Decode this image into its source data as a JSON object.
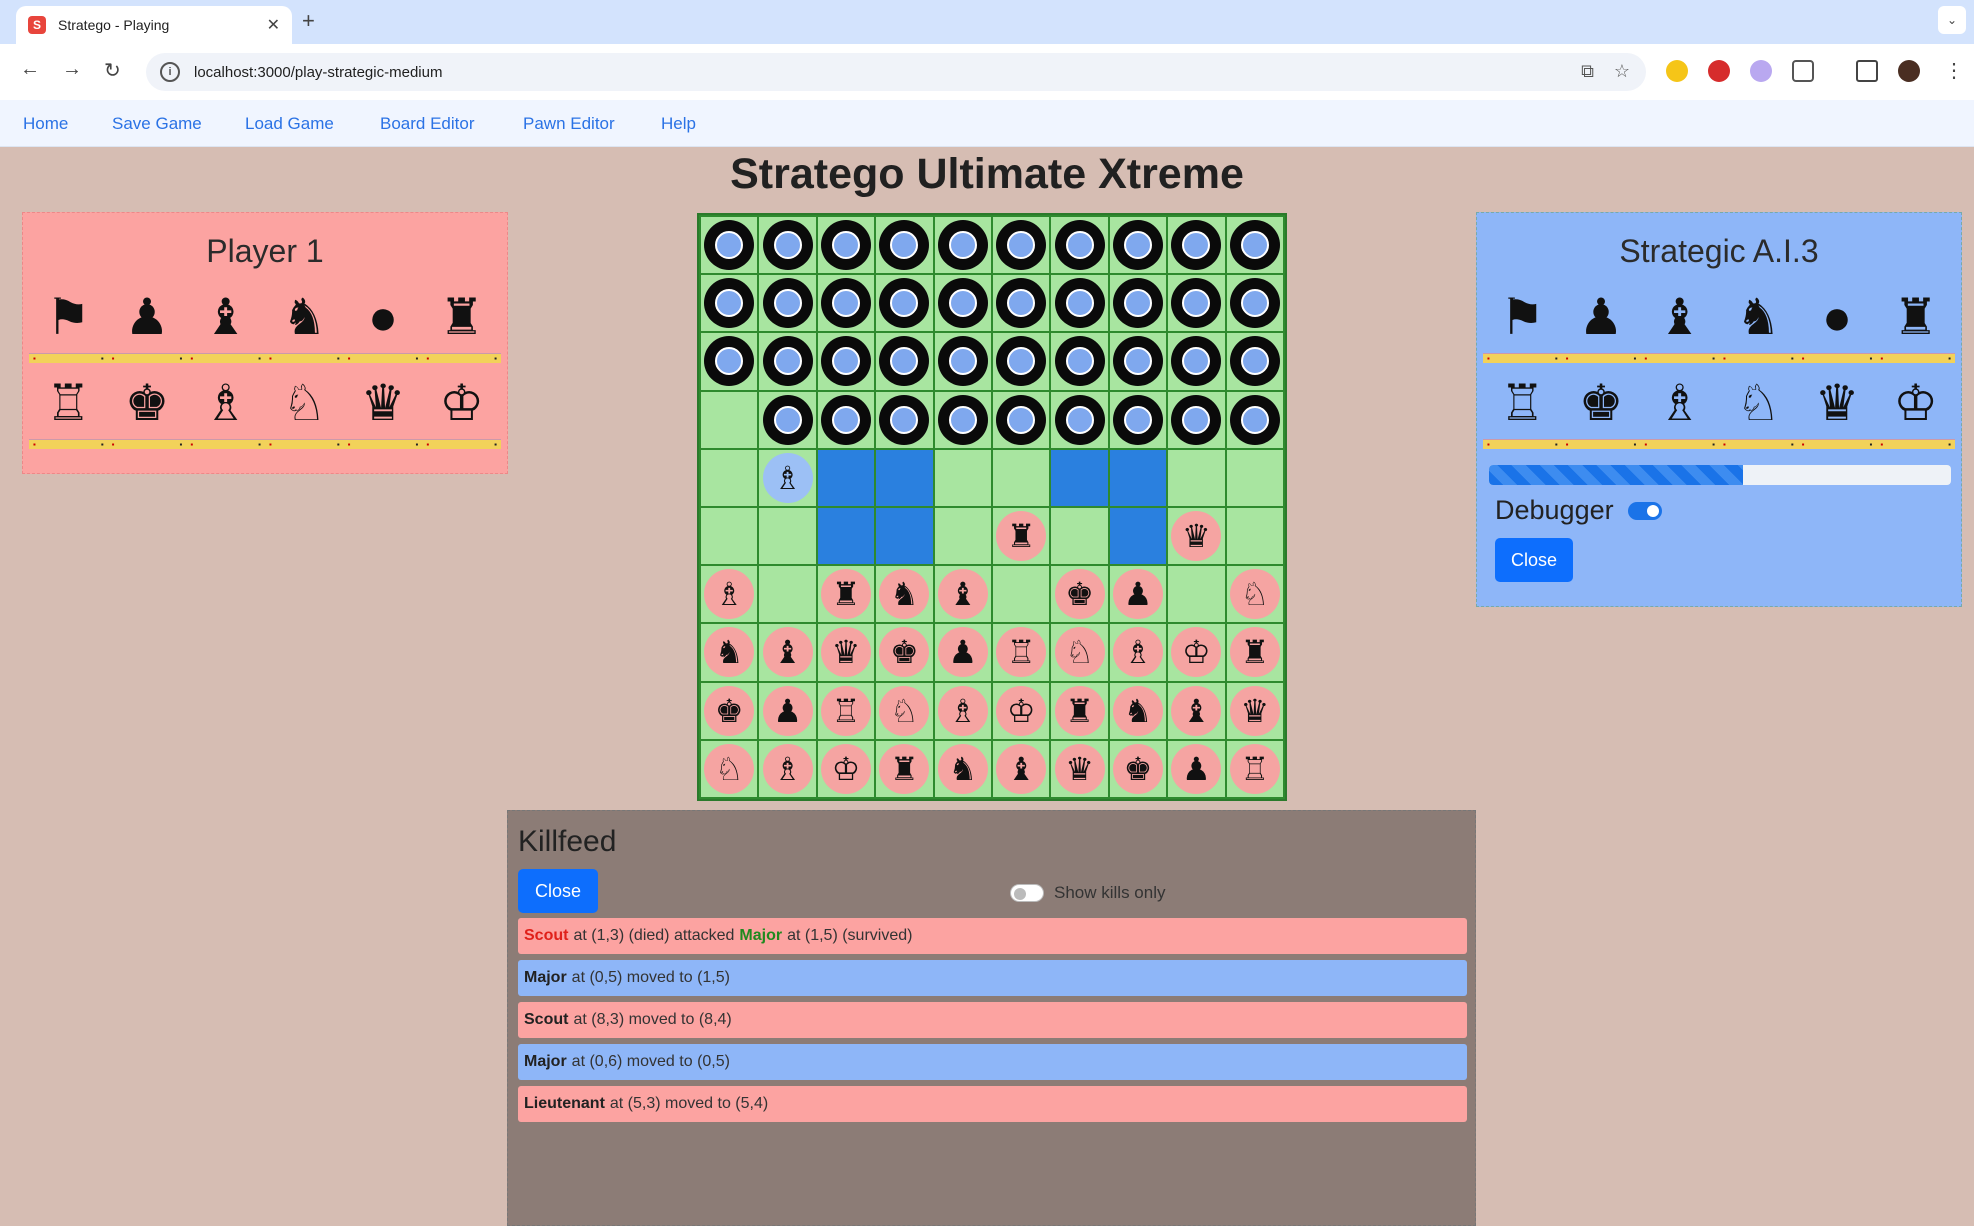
{
  "browser": {
    "tab_title": "Stratego - Playing",
    "tab_favicon": "S",
    "url": "localhost:3000/play-strategic-medium"
  },
  "appnav": {
    "links": [
      "Home",
      "Save Game",
      "Load Game",
      "Board Editor",
      "Pawn Editor",
      "Help"
    ]
  },
  "page_title": "Stratego Ultimate Xtreme",
  "player_panel": {
    "title": "Player 1"
  },
  "ai_panel": {
    "title": "Strategic A.I.3",
    "progress_fraction": 0.55,
    "debugger_label": "Debugger",
    "debugger_on": true,
    "close_label": "Close"
  },
  "board": {
    "rows": [
      "EEEEEEEEEE",
      "EEEEEEEEEE",
      "EEEEEEEEEE",
      ".EEEEEEEEE",
      ".SLL..LL..",
      "..LL.M.LM.",
      "M.MMM.MM.M",
      "MMMMMMMMMM",
      "MMMMMMMMMM",
      "MMMMMMMMMM"
    ],
    "legend": {
      "E": "enemy-piece",
      "M": "player-piece",
      "S": "selected-piece",
      "L": "lake",
      ".": "empty"
    }
  },
  "killfeed": {
    "title": "Killfeed",
    "close_label": "Close",
    "show_kills_only_label": "Show kills only",
    "show_kills_only": false,
    "entries": [
      {
        "side": "red",
        "piece": "Scout",
        "text": "at (1,3) (died) attacked",
        "target": "Major",
        "text2": "at (1,5) (survived)"
      },
      {
        "side": "blue",
        "piece": "Major",
        "text": "at (0,5) moved to (1,5)"
      },
      {
        "side": "red",
        "piece": "Scout",
        "text": "at (8,3) moved to (8,4)"
      },
      {
        "side": "blue",
        "piece": "Major",
        "text": "at (0,6) moved to (0,5)"
      },
      {
        "side": "red",
        "piece": "Lieutenant",
        "text": "at (5,3) moved to (5,4)"
      }
    ]
  }
}
